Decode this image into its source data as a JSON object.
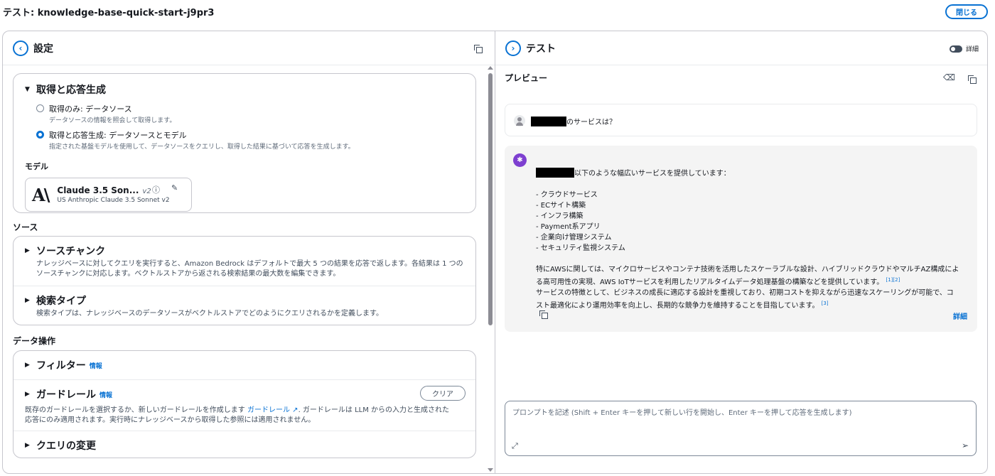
{
  "page": {
    "title": "テスト: knowledge-base-quick-start-j9pr3",
    "close_label": "閉じる"
  },
  "left_panel": {
    "title": "設定",
    "retrieval": {
      "title": "取得と応答生成",
      "options": [
        {
          "label": "取得のみ: データソース",
          "desc": "データソースの情報を照会して取得します。",
          "selected": false
        },
        {
          "label": "取得と応答生成: データソースとモデル",
          "desc": "指定された基盤モデルを使用して、データソースをクエリし、取得した結果に基づいて応答を生成します。",
          "selected": true
        }
      ],
      "model_label": "モデル",
      "model": {
        "name": "Claude 3.5 Son...",
        "version": "v2",
        "subtitle": "US Anthropic Claude 3.5 Sonnet v2",
        "logo": "A\\"
      }
    },
    "source_label": "ソース",
    "source_sections": [
      {
        "title": "ソースチャンク",
        "desc_line1": "ナレッジベースに対してクエリを実行すると、Amazon Bedrock はデフォルトで最大 5 つの結果を応答で返します。各結果は 1 つの",
        "desc_line2": "ソースチャンクに対応します。ベクトルストアから返される検索結果の最大数を編集できます。"
      },
      {
        "title": "検索タイプ",
        "desc_line1": "検索タイプは、ナレッジベースのデータソースがベクトルストアでどのようにクエリされるかを定義します。"
      }
    ],
    "data_ops_label": "データ操作",
    "filter": {
      "title": "フィルター",
      "info": "情報"
    },
    "guardrail": {
      "title": "ガードレール",
      "info": "情報",
      "clear_label": "クリア",
      "desc_pre": "既存のガードレールを選択するか、新しいガードレールを作成します",
      "link": "ガードレール",
      "desc_post": ". ガードレールは LLM からの入力と生成された",
      "desc_line2": "応答にのみ適用されます。実行時にナレッジベースから取得した参照には適用されません。"
    },
    "query": {
      "title": "クエリの変更"
    }
  },
  "right_panel": {
    "title": "テスト",
    "detail_toggle_label": "詳細",
    "preview_label": "プレビュー",
    "user_message": "のサービスは？",
    "ai_message": {
      "intro": "以下のような幅広いサービスを提供しています：",
      "items": [
        "- クラウドサービス",
        "- ECサイト構築",
        "- インフラ構築",
        "- Payment系アプリ",
        "- 企業向け管理システム",
        "- セキュリティ監視システム"
      ],
      "para1_line1": "特にAWSに関しては、マイクロサービスやコンテナ技術を活用したスケーラブルな設計、ハイブリッドクラウドやマルチAZ構成によ",
      "para1_line2": "る高可用性の実現、AWS IoTサービスを利用したリアルタイムデータ処理基盤の構築などを提供しています。",
      "cite1": "[1][2]",
      "para2_line1": "サービスの特徴として、ビジネスの成長に適応する設計を重視しており、初期コストを抑えながら迅速なスケーリングが可能で、コ",
      "para2_line2": "スト最適化により運用効率を向上し、長期的な競争力を維持することを目指しています。",
      "cite2": "[3]",
      "detail_link": "詳細"
    },
    "prompt_placeholder": "プロンプトを記述 (Shift + Enter キーを押して新しい行を開始し、Enter キーを押して応答を生成します)"
  }
}
